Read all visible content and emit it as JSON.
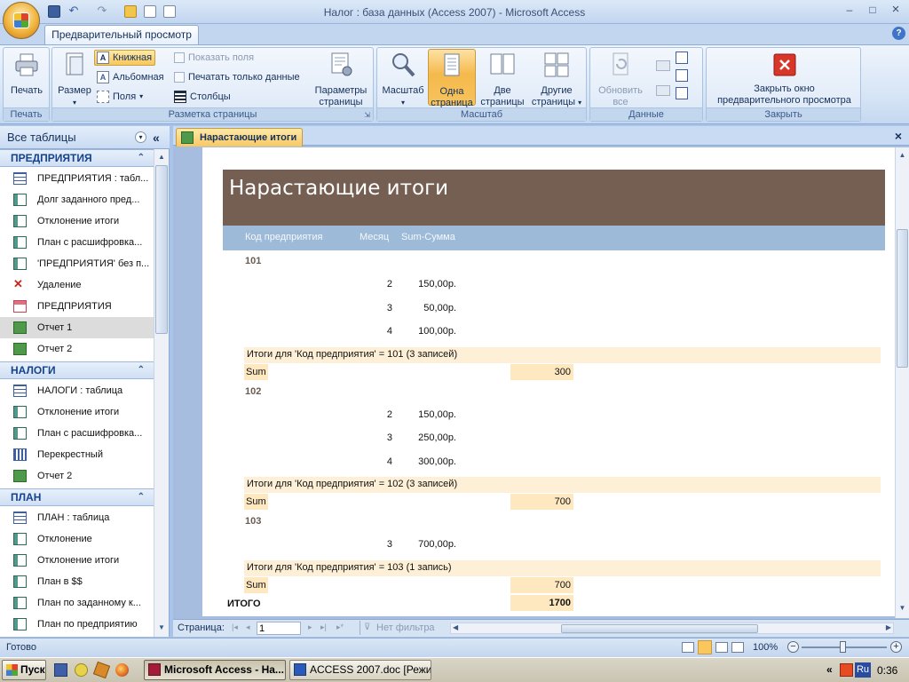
{
  "window": {
    "title": "Налог : база данных (Access 2007) - Microsoft Access",
    "minimize": "–",
    "maximize": "□",
    "close": "×"
  },
  "ribbon": {
    "tab": "Предварительный просмотр",
    "help": "?",
    "groups": {
      "print": {
        "label": "Печать",
        "print_btn": "Печать"
      },
      "layout": {
        "label": "Разметка страницы",
        "size_btn": "Размер",
        "portrait": "Книжная",
        "landscape": "Альбомная",
        "margins": "Поля",
        "show_margins": "Показать поля",
        "print_data_only": "Печатать только данные",
        "columns": "Столбцы",
        "page_setup_line1": "Параметры",
        "page_setup_line2": "страницы"
      },
      "zoom": {
        "label": "Масштаб",
        "zoom_btn": "Масштаб",
        "one_page_line1": "Одна",
        "one_page_line2": "страница",
        "two_pages_line1": "Две",
        "two_pages_line2": "страницы",
        "more_pages_line1": "Другие",
        "more_pages_line2": "страницы"
      },
      "data": {
        "label": "Данные",
        "refresh_line1": "Обновить",
        "refresh_line2": "все"
      },
      "close": {
        "label": "Закрыть",
        "close_line1": "Закрыть окно",
        "close_line2": "предварительного просмотра"
      }
    }
  },
  "nav": {
    "header": "Все таблицы",
    "collapse": "«",
    "sections": [
      {
        "title": "ПРЕДПРИЯТИЯ",
        "items": [
          {
            "label": "ПРЕДПРИЯТИЯ : табл...",
            "icon": "table-icon"
          },
          {
            "label": "Долг заданного пред...",
            "icon": "query-icon"
          },
          {
            "label": "Отклонение итоги",
            "icon": "query-icon"
          },
          {
            "label": "План с расшифровка...",
            "icon": "query-icon"
          },
          {
            "label": "'ПРЕДПРИЯТИЯ' без п...",
            "icon": "query-icon"
          },
          {
            "label": "Удаление",
            "icon": "delete-query-icon"
          },
          {
            "label": "ПРЕДПРИЯТИЯ",
            "icon": "form-icon"
          },
          {
            "label": "Отчет 1",
            "icon": "report-icon",
            "active": true
          },
          {
            "label": "Отчет 2",
            "icon": "report-icon"
          }
        ]
      },
      {
        "title": "НАЛОГИ",
        "items": [
          {
            "label": "НАЛОГИ : таблица",
            "icon": "table-icon"
          },
          {
            "label": "Отклонение итоги",
            "icon": "query-icon"
          },
          {
            "label": "План с расшифровка...",
            "icon": "query-icon"
          },
          {
            "label": "Перекрестный",
            "icon": "crosstab-icon"
          },
          {
            "label": "Отчет 2",
            "icon": "report-icon"
          }
        ]
      },
      {
        "title": "ПЛАН",
        "items": [
          {
            "label": "ПЛАН : таблица",
            "icon": "table-icon"
          },
          {
            "label": "Отклонение",
            "icon": "query-icon"
          },
          {
            "label": "Отклонение итоги",
            "icon": "query-icon"
          },
          {
            "label": "План в $$",
            "icon": "query-icon"
          },
          {
            "label": "План по заданному к...",
            "icon": "query-icon"
          },
          {
            "label": "План по предприятию",
            "icon": "query-icon"
          },
          {
            "label": "План с расшифровка...",
            "icon": "query-icon"
          }
        ]
      }
    ]
  },
  "doc": {
    "tab_title": "Нарастающие итоги",
    "close": "×"
  },
  "report": {
    "title": "Нарастающие итоги",
    "columns": [
      "Код предприятия",
      "Месяц",
      "Sum-Сумма"
    ],
    "groups": [
      {
        "code": "101",
        "rows": [
          {
            "month": "2",
            "sum": "150,00р."
          },
          {
            "month": "3",
            "sum": "50,00р."
          },
          {
            "month": "4",
            "sum": "100,00р."
          }
        ],
        "footer": "Итоги для 'Код предприятия' =  101 (3 записей)",
        "sum_label": "Sum",
        "sum": "300"
      },
      {
        "code": "102",
        "rows": [
          {
            "month": "2",
            "sum": "150,00р."
          },
          {
            "month": "3",
            "sum": "250,00р."
          },
          {
            "month": "4",
            "sum": "300,00р."
          }
        ],
        "footer": "Итоги для 'Код предприятия' =  102 (3 записей)",
        "sum_label": "Sum",
        "sum": "700"
      },
      {
        "code": "103",
        "rows": [
          {
            "month": "3",
            "sum": "700,00р."
          }
        ],
        "footer": "Итоги для 'Код предприятия' =  103 (1 запись)",
        "sum_label": "Sum",
        "sum": "700"
      }
    ],
    "grand_label": "ИТОГО",
    "grand_total": "1700"
  },
  "record_nav": {
    "label": "Страница:",
    "page": "1",
    "filter": "Нет фильтра"
  },
  "status": {
    "ready": "Готово",
    "zoom": "100%"
  },
  "taskbar": {
    "start": "Пуск",
    "task1": "Microsoft Access - На...",
    "task2": "ACCESS 2007.doc [Режи...",
    "lang": "Ru",
    "clock": "0:36"
  },
  "colors": {
    "report_header": "#755e52",
    "column_header": "#9dbbd8",
    "group_footer": "#fdf0d6",
    "ribbon_selected": "#f9c75c"
  }
}
